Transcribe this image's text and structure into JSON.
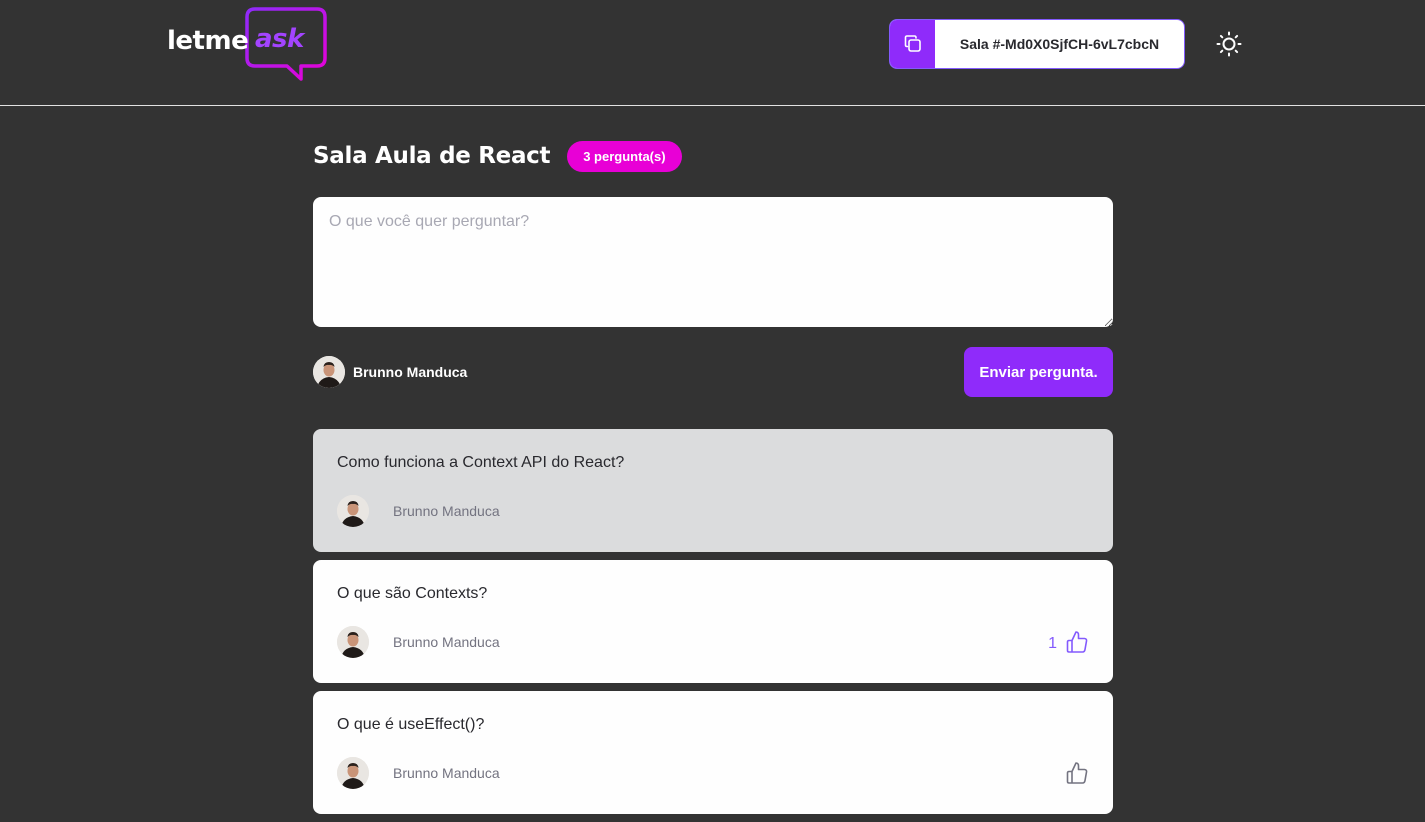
{
  "header": {
    "logo": {
      "text_1": "letme",
      "text_2": "ask"
    },
    "room_code": {
      "label": "Sala #-Md0X0SjfCH-6vL7cbcN"
    },
    "theme_icon": "sun-icon"
  },
  "room": {
    "title": "Sala Aula de React",
    "question_count": "3 pergunta(s)"
  },
  "form": {
    "placeholder": "O que você quer perguntar?",
    "value": "",
    "user_name": "Brunno Manduca",
    "submit_label": "Enviar pergunta."
  },
  "questions": [
    {
      "content": "Como funciona a Context API do React?",
      "author": "Brunno Manduca",
      "highlighted": true,
      "like_count": "",
      "liked": false,
      "show_like": false
    },
    {
      "content": "O que são Contexts?",
      "author": "Brunno Manduca",
      "highlighted": false,
      "like_count": "1",
      "liked": true,
      "show_like": true
    },
    {
      "content": "O que é useEffect()?",
      "author": "Brunno Manduca",
      "highlighted": false,
      "like_count": "",
      "liked": false,
      "show_like": true
    }
  ],
  "colors": {
    "accent": "#8f2bfa",
    "badge": "#e800d6",
    "background": "#333333",
    "liked": "#835afd",
    "unliked": "#737380"
  }
}
